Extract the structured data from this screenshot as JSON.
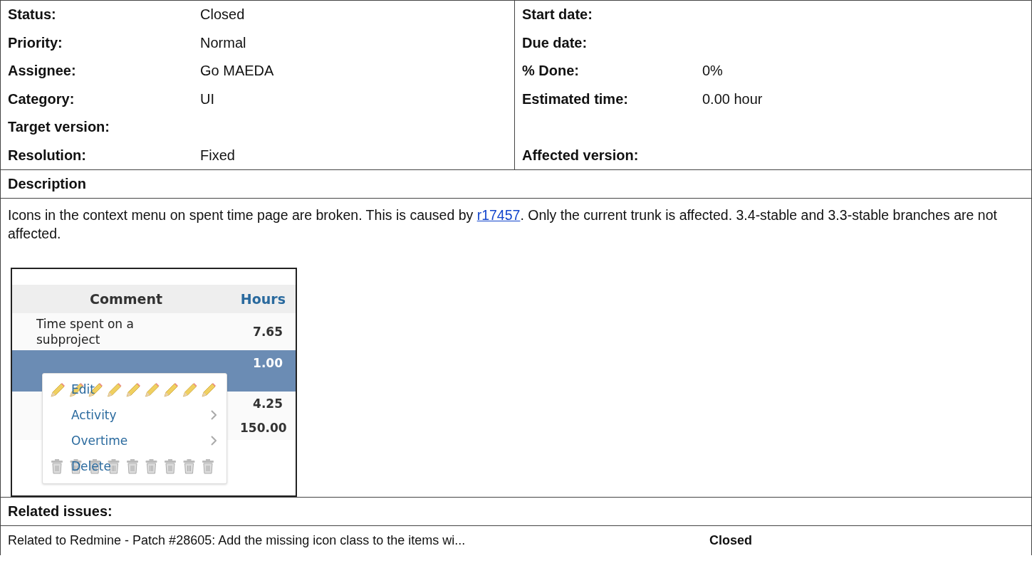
{
  "attributes": [
    {
      "left": {
        "label": "Status:",
        "value": "Closed"
      },
      "right": {
        "label": "Start date:"
      }
    },
    {
      "left": {
        "label": "Priority:",
        "value": "Normal"
      },
      "right": {
        "label": "Due date:"
      }
    },
    {
      "left": {
        "label": "Assignee:",
        "value": "Go MAEDA"
      },
      "right": {
        "label": "% Done:",
        "value": "0%"
      }
    },
    {
      "left": {
        "label": "Category:",
        "value": "UI"
      },
      "right": {
        "label": "Estimated time:",
        "value": "0.00 hour"
      }
    },
    {
      "left": {
        "label": "Target version:"
      }
    },
    {
      "left": {
        "label": "Resolution:",
        "value": "Fixed"
      },
      "right": {
        "label": "Affected version:"
      }
    }
  ],
  "description": {
    "heading": "Description",
    "text_before": "Icons in the context menu on spent time page are broken. This is caused by ",
    "link": "r17457",
    "text_after": ". Only the current trunk is affected. 3.4-stable and 3.3-stable branches are not affected.",
    "screenshot": {
      "columns": [
        "Comment",
        "Hours"
      ],
      "rows": [
        {
          "comment": "Time spent on a subproject",
          "hours": "7.65",
          "selected": false
        },
        {
          "hours": "1.00",
          "selected": true
        },
        {
          "hours": "4.25",
          "selected": false
        },
        {
          "hours": "150.00",
          "selected": false
        }
      ],
      "context_menu": [
        {
          "label": "Edit",
          "kind": "pencil"
        },
        {
          "label": "Activity",
          "kind": "submenu"
        },
        {
          "label": "Overtime",
          "kind": "submenu"
        },
        {
          "label": "Delete",
          "kind": "trash"
        }
      ]
    }
  },
  "related": {
    "heading": "Related issues:",
    "items": [
      {
        "text": "Related to Redmine - Patch #28605: Add the missing icon class to the items wi...",
        "status": "Closed"
      }
    ]
  }
}
